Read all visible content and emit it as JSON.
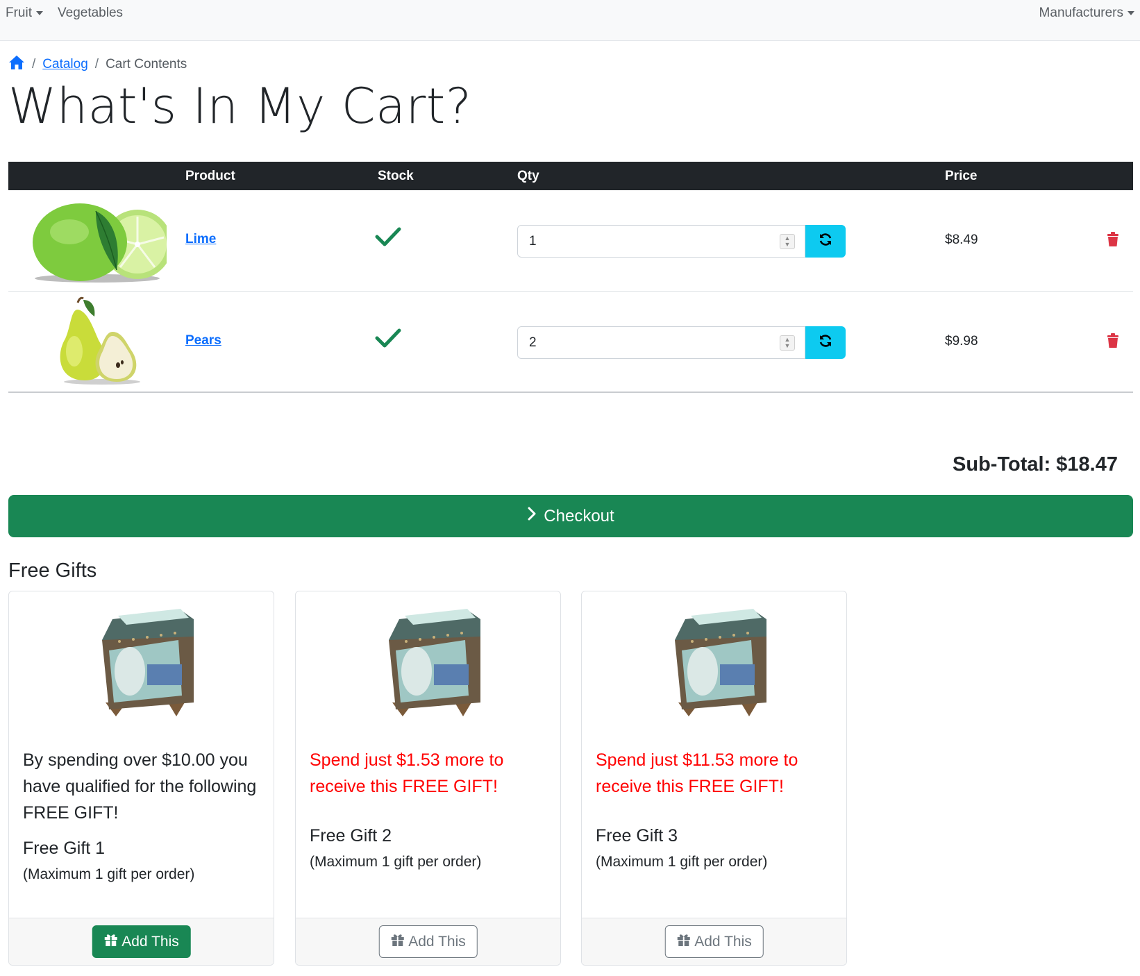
{
  "nav": {
    "fruit": "Fruit",
    "vegetables": "Vegetables",
    "manufacturers": "Manufacturers"
  },
  "breadcrumb": {
    "catalog": "Catalog",
    "current": "Cart Contents"
  },
  "page_title": "What's In My Cart?",
  "table": {
    "headers": {
      "product": "Product",
      "stock": "Stock",
      "qty": "Qty",
      "price": "Price"
    },
    "rows": [
      {
        "product": "Lime",
        "qty": "1",
        "price": "$8.49",
        "in_stock": true
      },
      {
        "product": "Pears",
        "qty": "2",
        "price": "$9.98",
        "in_stock": true
      }
    ]
  },
  "subtotal": "Sub-Total: $18.47",
  "checkout_label": "Checkout",
  "gifts": {
    "heading": "Free Gifts",
    "items": [
      {
        "message": "By spending over $10.00 you have qualified for the following FREE GIFT!",
        "name": "Free Gift 1",
        "limit": "(Maximum 1 gift per order)",
        "button": "Add This",
        "qualified": true
      },
      {
        "message": "Spend just $1.53 more to receive this FREE GIFT!",
        "name": "Free Gift 2",
        "limit": "(Maximum 1 gift per order)",
        "button": "Add This",
        "qualified": false
      },
      {
        "message": "Spend just $11.53 more to receive this FREE GIFT!",
        "name": "Free Gift 3",
        "limit": "(Maximum 1 gift per order)",
        "button": "Add This",
        "qualified": false
      }
    ]
  },
  "colors": {
    "header_dark": "#212529",
    "link_blue": "#0d6efd",
    "success_green": "#198754",
    "info_cyan": "#0dcaf0",
    "danger_red": "#dc3545",
    "warning_text": "#ff0000"
  },
  "icons": {
    "home": "home-icon",
    "check": "check-icon",
    "refresh": "refresh-icon",
    "trash": "trash-icon",
    "chevron": "chevron-right-icon",
    "gift": "gift-icon"
  }
}
